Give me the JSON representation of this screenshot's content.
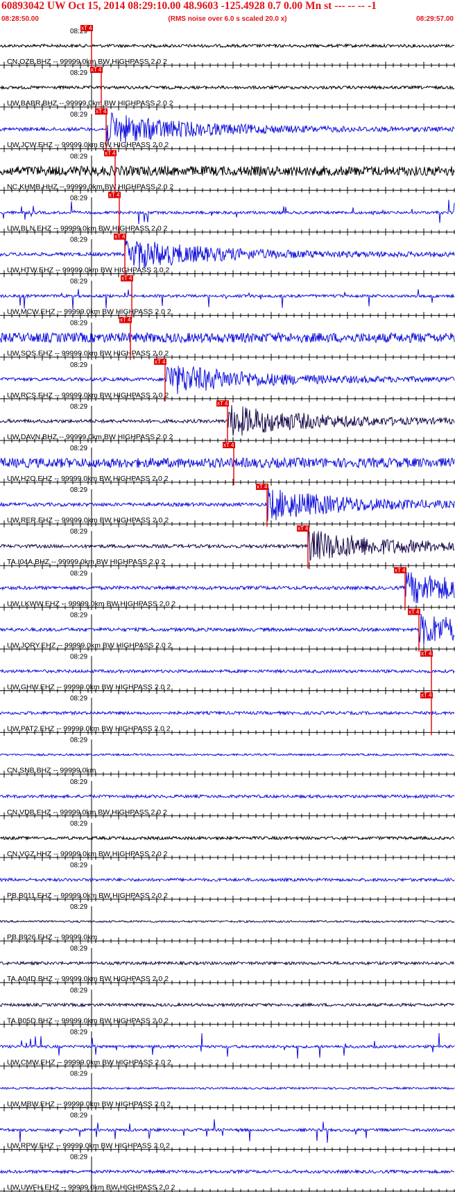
{
  "header": {
    "title": "60893042 UW Oct 15, 2014 08:29:10.00   48.9603 -125.4928  0.7 0.00 Mn st --- -- --  -1",
    "start_time": "08:28:50.00",
    "center_note": "(RMS noise over 6.0 s scaled 20.0 x)",
    "end_time": "08:29:57.00"
  },
  "colors": {
    "header_red": "#e3131b",
    "pick_red": "#e00000",
    "trace_blue": "#1010dd",
    "trace_black": "#000000",
    "trace_navy": "#1a0a4a"
  },
  "minute_label": "08:29",
  "pick_label": "xT 4",
  "traces": [
    {
      "label": "CN.OZB.BHZ -- 99999.0km BW  HIGHPASS  2.0  2",
      "time_label": "08:29",
      "color": "#000000",
      "amplitude": "low",
      "pick": "xT 4"
    },
    {
      "label": "UW.BABR.BHZ -- 99999.0km BW  HIGHPASS  2.0  2",
      "time_label": "08:29",
      "color": "#000000",
      "amplitude": "low",
      "pick": "xT 4"
    },
    {
      "label": "UW.JCW.EHZ -- 99999.0km BW  HIGHPASS  2.0  2",
      "time_label": "08:29",
      "color": "#1010dd",
      "amplitude": "burst",
      "pick": "xT 4"
    },
    {
      "label": "NC.KHMB.HHZ -- 99999.0km BW  HIGHPASS  2.0  2",
      "time_label": "08:29",
      "color": "#000000",
      "amplitude": "high",
      "pick": "xT 4"
    },
    {
      "label": "UW.BLN.EHZ -- 99999.0km BW  HIGHPASS  2.0  2",
      "time_label": "08:29",
      "color": "#1010dd",
      "amplitude": "spikes",
      "pick": "xT 4"
    },
    {
      "label": "UW.HTW.EHZ -- 99999.0km BW  HIGHPASS  2.0  2",
      "time_label": "08:29",
      "color": "#1010dd",
      "amplitude": "burst",
      "pick": "xT 4"
    },
    {
      "label": "UW.MCW.EHZ -- 99999.0km BW  HIGHPASS  2.0  2",
      "time_label": "08:29",
      "color": "#1010dd",
      "amplitude": "spikes",
      "pick": "xT 4"
    },
    {
      "label": "UW.SQS.EHZ -- 99999.0km BW  HIGHPASS  2.0  2",
      "time_label": "08:29",
      "color": "#1010dd",
      "amplitude": "high",
      "pick": "xT 4"
    },
    {
      "label": "UW.RCS.EHZ -- 99999.0km BW  HIGHPASS  2.0  2",
      "time_label": "08:29",
      "color": "#1010dd",
      "amplitude": "burst",
      "pick": "xT 4"
    },
    {
      "label": "UW.DAVN.BHZ -- 99999.0km BW  HIGHPASS  2.0  2",
      "time_label": "08:29",
      "color": "#1a0a4a",
      "amplitude": "burst",
      "pick": "xT 4"
    },
    {
      "label": "UW.H2O.EHZ -- 99999.0km BW  HIGHPASS  2.0  2",
      "time_label": "08:29",
      "color": "#1010dd",
      "amplitude": "high",
      "pick": "xT 4"
    },
    {
      "label": "UW.RER.EHZ -- 99999.0km BW  HIGHPASS  2.0  2",
      "time_label": "08:29",
      "color": "#1010dd",
      "amplitude": "burst",
      "pick": "xT 4"
    },
    {
      "label": "TA.I04A.BHZ -- 99999.0km BW  HIGHPASS  2.0  2",
      "time_label": "08:29",
      "color": "#1a0a4a",
      "amplitude": "burst",
      "pick": "xT 4"
    },
    {
      "label": "UW.LKWW.EHZ -- 99999.0km BW  HIGHPASS  2.0  2",
      "time_label": "08:29",
      "color": "#1010dd",
      "amplitude": "burst",
      "pick": "xT 4"
    },
    {
      "label": "UW.JORY.EHZ -- 99999.0km BW  HIGHPASS  2.0  2",
      "time_label": "08:29",
      "color": "#1010dd",
      "amplitude": "burst",
      "pick": "xT 4"
    },
    {
      "label": "UW.GHW.EHZ -- 99999.0km BW  HIGHPASS  2.0  2",
      "time_label": "08:29",
      "color": "#1010dd",
      "amplitude": "low",
      "pick": "xT 4"
    },
    {
      "label": "UW.PAT2.EHZ -- 99999.0km BW  HIGHPASS  2.0  2",
      "time_label": "08:29",
      "color": "#1010dd",
      "amplitude": "low",
      "pick": "xT 4"
    },
    {
      "label": "CN.SNB.BHZ -- 99999.0km",
      "time_label": "08:29",
      "color": "#1010dd",
      "amplitude": "flat",
      "pick": ""
    },
    {
      "label": "CN.VDB.EHZ -- 99999.0km BW  HIGHPASS  2.0  2",
      "time_label": "08:29",
      "color": "#1010dd",
      "amplitude": "low",
      "pick": ""
    },
    {
      "label": "CN.VGZ.HHZ -- 99999.0km BW  HIGHPASS  2.0  2",
      "time_label": "08:29",
      "color": "#000000",
      "amplitude": "low",
      "pick": ""
    },
    {
      "label": "PB.B011.EHZ -- 99999.0km BW  HIGHPASS  2.0  2",
      "time_label": "08:29",
      "color": "#1010dd",
      "amplitude": "low",
      "pick": ""
    },
    {
      "label": "PB.B926.EHZ -- 99999.0km",
      "time_label": "08:29",
      "color": "#1a0a4a",
      "amplitude": "flat",
      "pick": ""
    },
    {
      "label": "TA.A04D.BHZ -- 99999.0km BW  HIGHPASS  2.0  2",
      "time_label": "08:29",
      "color": "#1a0a4a",
      "amplitude": "low",
      "pick": ""
    },
    {
      "label": "TA.B05D.BHZ -- 99999.0km BW  HIGHPASS  2.0  2",
      "time_label": "08:29",
      "color": "#1a0a4a",
      "amplitude": "low",
      "pick": ""
    },
    {
      "label": "UW.CMW.EHZ -- 99999.0km BW  HIGHPASS  2.0  2",
      "time_label": "08:29",
      "color": "#1010dd",
      "amplitude": "spikes",
      "pick": ""
    },
    {
      "label": "UW.MBW.EHZ -- 99999.0km BW  HIGHPASS  2.0  2",
      "time_label": "08:29",
      "color": "#1010dd",
      "amplitude": "flat",
      "pick": ""
    },
    {
      "label": "UW.RPW.EHZ -- 99999.0km BW  HIGHPASS  2.0  2",
      "time_label": "08:29",
      "color": "#1010dd",
      "amplitude": "spikes",
      "pick": ""
    },
    {
      "label": "UW.UWFH.EHZ -- 99999.0km BW  HIGHPASS  2.0  2",
      "time_label": "08:29",
      "color": "#1010dd",
      "amplitude": "low",
      "pick": ""
    }
  ]
}
